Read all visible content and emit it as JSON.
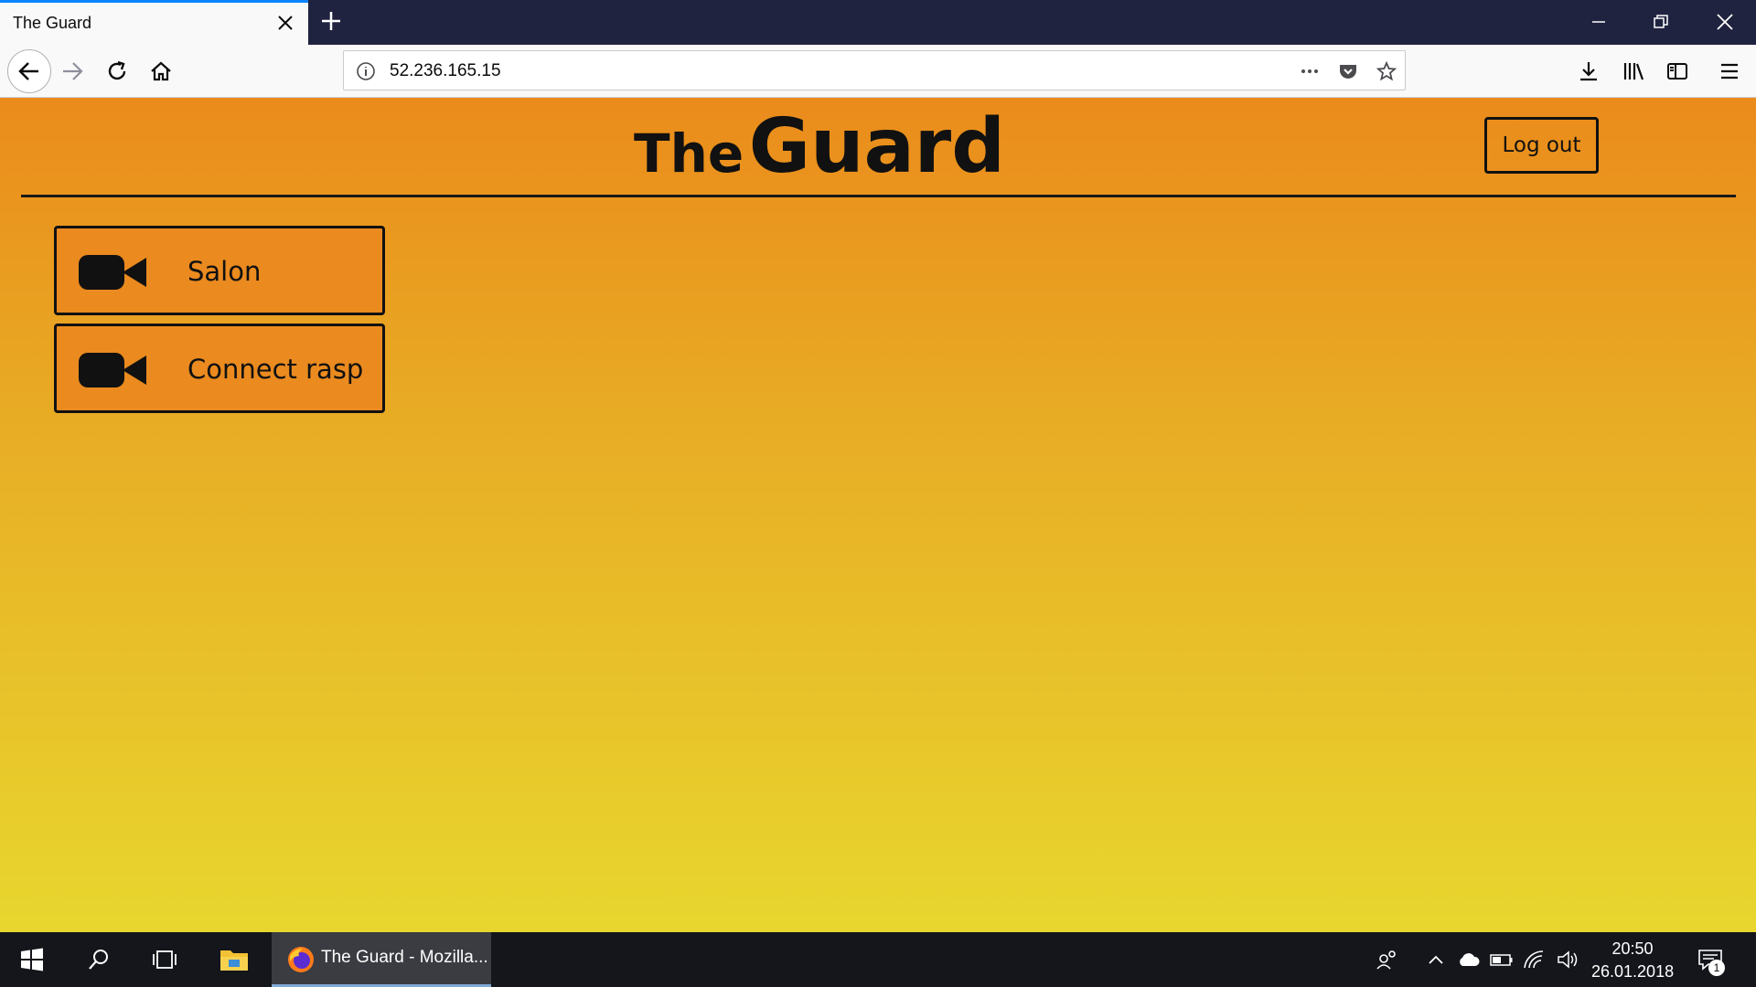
{
  "browser": {
    "tab_title": "The Guard",
    "url": "52.236.165.15",
    "accent_color": "#0a84ff"
  },
  "page": {
    "title_small": "The",
    "title_large": "Guard",
    "logout_label": "Log out",
    "cameras": [
      {
        "label": "Salon",
        "icon": "video-camera-icon"
      },
      {
        "label": "Connect rasp",
        "icon": "video-camera-icon"
      }
    ],
    "gradient": {
      "top": "#ea8b1b",
      "bottom": "#e8d62e"
    }
  },
  "taskbar": {
    "app_label": "The Guard - Mozilla...",
    "time": "20:50",
    "date": "26.01.2018",
    "notification_count": "1"
  }
}
